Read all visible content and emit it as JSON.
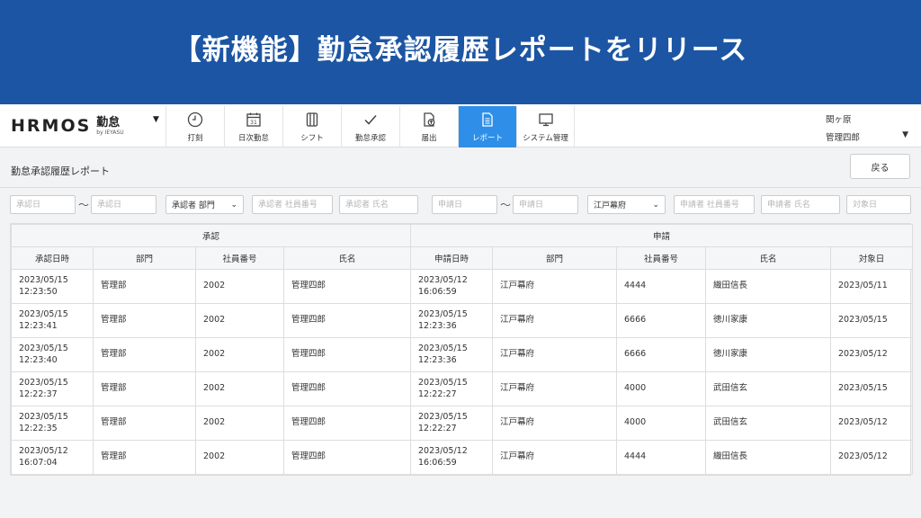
{
  "banner": {
    "title": "【新機能】勤怠承認履歴レポートをリリース"
  },
  "brand": {
    "logo": "HRMOS",
    "product": "勤怠",
    "by": "by IEYASU",
    "caret": "▼"
  },
  "nav": {
    "items": [
      {
        "label": "打刻",
        "icon": "clock-icon"
      },
      {
        "label": "日次勤怠",
        "icon": "calendar-icon"
      },
      {
        "label": "シフト",
        "icon": "shift-icon"
      },
      {
        "label": "勤怠承認",
        "icon": "check-icon"
      },
      {
        "label": "届出",
        "icon": "document-upload-icon"
      },
      {
        "label": "レポート",
        "icon": "report-icon",
        "active": true
      },
      {
        "label": "システム管理",
        "icon": "monitor-icon"
      }
    ]
  },
  "user": {
    "company": "関ヶ原",
    "name": "管理四郎",
    "caret": "▼"
  },
  "page": {
    "title": "勤怠承認履歴レポート",
    "back_label": "戻る"
  },
  "filters": {
    "approve_date_from": "承認日",
    "tilde": "〜",
    "approve_date_to": "承認日",
    "approver_dept": "承認者 部門",
    "approver_empno": "承認者 社員番号",
    "approver_name": "承認者 氏名",
    "apply_date_from": "申請日",
    "apply_date_to": "申請日",
    "applicant_dept": "江戸幕府",
    "applicant_empno": "申請者 社員番号",
    "applicant_name": "申請者 氏名",
    "target_date": "対象日",
    "select_caret": "⌄"
  },
  "table": {
    "group_headers": {
      "approval": "承認",
      "application": "申請"
    },
    "columns": [
      "承認日時",
      "部門",
      "社員番号",
      "氏名",
      "申請日時",
      "部門",
      "社員番号",
      "氏名",
      "対象日"
    ],
    "rows": [
      {
        "approve_date": "2023/05/15",
        "approve_time": "12:23:50",
        "approver_dept": "管理部",
        "approver_empno": "2002",
        "approver_name": "管理四郎",
        "apply_date": "2023/05/12",
        "apply_time": "16:06:59",
        "applicant_dept": "江戸幕府",
        "applicant_empno": "4444",
        "applicant_name": "織田信長",
        "target_date": "2023/05/11"
      },
      {
        "approve_date": "2023/05/15",
        "approve_time": "12:23:41",
        "approver_dept": "管理部",
        "approver_empno": "2002",
        "approver_name": "管理四郎",
        "apply_date": "2023/05/15",
        "apply_time": "12:23:36",
        "applicant_dept": "江戸幕府",
        "applicant_empno": "6666",
        "applicant_name": "徳川家康",
        "target_date": "2023/05/15"
      },
      {
        "approve_date": "2023/05/15",
        "approve_time": "12:23:40",
        "approver_dept": "管理部",
        "approver_empno": "2002",
        "approver_name": "管理四郎",
        "apply_date": "2023/05/15",
        "apply_time": "12:23:36",
        "applicant_dept": "江戸幕府",
        "applicant_empno": "6666",
        "applicant_name": "徳川家康",
        "target_date": "2023/05/12"
      },
      {
        "approve_date": "2023/05/15",
        "approve_time": "12:22:37",
        "approver_dept": "管理部",
        "approver_empno": "2002",
        "approver_name": "管理四郎",
        "apply_date": "2023/05/15",
        "apply_time": "12:22:27",
        "applicant_dept": "江戸幕府",
        "applicant_empno": "4000",
        "applicant_name": "武田信玄",
        "target_date": "2023/05/15"
      },
      {
        "approve_date": "2023/05/15",
        "approve_time": "12:22:35",
        "approver_dept": "管理部",
        "approver_empno": "2002",
        "approver_name": "管理四郎",
        "apply_date": "2023/05/15",
        "apply_time": "12:22:27",
        "applicant_dept": "江戸幕府",
        "applicant_empno": "4000",
        "applicant_name": "武田信玄",
        "target_date": "2023/05/12"
      },
      {
        "approve_date": "2023/05/12",
        "approve_time": "16:07:04",
        "approver_dept": "管理部",
        "approver_empno": "2002",
        "approver_name": "管理四郎",
        "apply_date": "2023/05/12",
        "apply_time": "16:06:59",
        "applicant_dept": "江戸幕府",
        "applicant_empno": "4444",
        "applicant_name": "織田信長",
        "target_date": "2023/05/12"
      }
    ]
  },
  "colors": {
    "banner": "#1c55a3",
    "active_nav": "#2f8fe8"
  }
}
